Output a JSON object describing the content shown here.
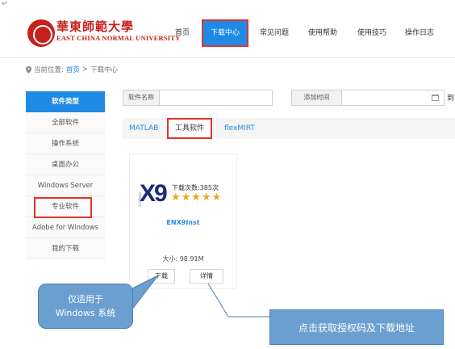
{
  "corner_mark": "↵",
  "header": {
    "logo_cn": "華東師範大學",
    "logo_en": "EAST CHINA NORMAL UNIVERSITY",
    "nav": [
      {
        "label": "首页",
        "active": false
      },
      {
        "label": "下载中心",
        "active": true
      },
      {
        "label": "常见问题",
        "active": false
      },
      {
        "label": "使用帮助",
        "active": false
      },
      {
        "label": "使用技巧",
        "active": false
      },
      {
        "label": "操作日志",
        "active": false
      }
    ]
  },
  "breadcrumb": {
    "prefix": "当前位置:",
    "home": "首页",
    "separator": ">",
    "current": "下载中心"
  },
  "sidebar": {
    "title": "软件类型",
    "items": [
      "全部软件",
      "操作系统",
      "桌面办公",
      "Windows Server",
      "专业软件",
      "Adobe for Windows",
      "我的下载"
    ],
    "highlighted": "专业软件"
  },
  "filters": {
    "name_label": "软件名称",
    "name_value": "",
    "time_label": "添加时间",
    "time_value": "",
    "cutoff_text": "到"
  },
  "tabs": [
    {
      "label": "MATLAB",
      "active": false
    },
    {
      "label": "工具软件",
      "active": true
    },
    {
      "label": "flexMIRT",
      "active": false
    }
  ],
  "card": {
    "logo_text": "X9",
    "logo_side_text": "EndNote",
    "downloads": "下载次数:385次",
    "rating": 5,
    "stars": "★★★★★",
    "name": "ENX9Inst",
    "size": "大小: 98.91M",
    "download_btn": "下载",
    "details_btn": "详情"
  },
  "callouts": {
    "bubble_line1": "仅适用于",
    "bubble_line2": "Windows 系统",
    "box_text": "点击获取授权码及下载地址"
  },
  "colors": {
    "primary_blue": "#1f8ae5",
    "highlight_red": "#e0332b",
    "brand_red": "#c8201a",
    "callout_blue": "#6a9fd0",
    "star_orange": "#f0a51a"
  }
}
